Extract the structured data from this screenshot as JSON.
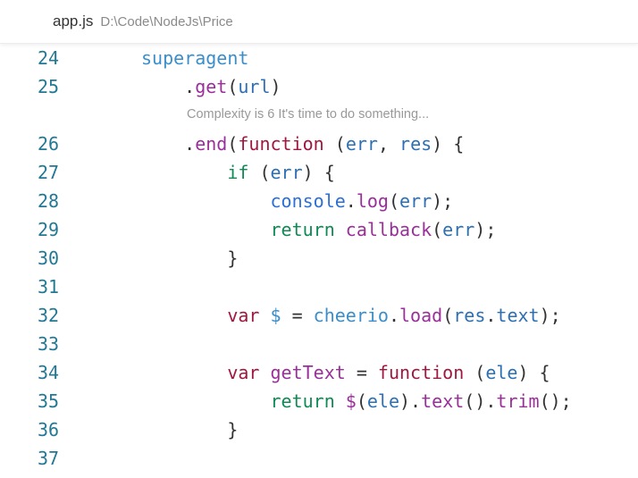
{
  "tab": {
    "title": "app.js",
    "path": "D:\\Code\\NodeJs\\Price"
  },
  "codelens": "Complexity is 6 It's time to do something...",
  "lines": [
    {
      "num": "24",
      "tokens": [
        {
          "t": "    superagent",
          "c": "k-ident"
        }
      ]
    },
    {
      "num": "25",
      "tokens": [
        {
          "t": "        .",
          "c": "k-punc"
        },
        {
          "t": "get",
          "c": "k-fn"
        },
        {
          "t": "(",
          "c": "k-punc"
        },
        {
          "t": "url",
          "c": "k-param"
        },
        {
          "t": ")",
          "c": "k-punc"
        }
      ]
    },
    {
      "num": "26",
      "tokens": [
        {
          "t": "        .",
          "c": "k-punc"
        },
        {
          "t": "end",
          "c": "k-fn"
        },
        {
          "t": "(",
          "c": "k-punc"
        },
        {
          "t": "function",
          "c": "k-kw"
        },
        {
          "t": " (",
          "c": "k-punc"
        },
        {
          "t": "err",
          "c": "k-param"
        },
        {
          "t": ", ",
          "c": "k-punc"
        },
        {
          "t": "res",
          "c": "k-param"
        },
        {
          "t": ") {",
          "c": "k-punc"
        }
      ]
    },
    {
      "num": "27",
      "tokens": [
        {
          "t": "            ",
          "c": "k-punc"
        },
        {
          "t": "if",
          "c": "k-ctrl"
        },
        {
          "t": " (",
          "c": "k-punc"
        },
        {
          "t": "err",
          "c": "k-param"
        },
        {
          "t": ") {",
          "c": "k-punc"
        }
      ]
    },
    {
      "num": "28",
      "tokens": [
        {
          "t": "                ",
          "c": "k-punc"
        },
        {
          "t": "console",
          "c": "k-obj"
        },
        {
          "t": ".",
          "c": "k-punc"
        },
        {
          "t": "log",
          "c": "k-fn"
        },
        {
          "t": "(",
          "c": "k-punc"
        },
        {
          "t": "err",
          "c": "k-param"
        },
        {
          "t": ");",
          "c": "k-punc"
        }
      ]
    },
    {
      "num": "29",
      "tokens": [
        {
          "t": "                ",
          "c": "k-punc"
        },
        {
          "t": "return",
          "c": "k-ctrl"
        },
        {
          "t": " ",
          "c": "k-punc"
        },
        {
          "t": "callback",
          "c": "k-fn"
        },
        {
          "t": "(",
          "c": "k-punc"
        },
        {
          "t": "err",
          "c": "k-param"
        },
        {
          "t": ");",
          "c": "k-punc"
        }
      ]
    },
    {
      "num": "30",
      "tokens": [
        {
          "t": "            }",
          "c": "k-punc"
        }
      ]
    },
    {
      "num": "31",
      "tokens": []
    },
    {
      "num": "32",
      "tokens": [
        {
          "t": "            ",
          "c": "k-punc"
        },
        {
          "t": "var",
          "c": "k-kw"
        },
        {
          "t": " ",
          "c": "k-punc"
        },
        {
          "t": "$",
          "c": "k-dollar"
        },
        {
          "t": " = ",
          "c": "k-punc"
        },
        {
          "t": "cheerio",
          "c": "k-ident"
        },
        {
          "t": ".",
          "c": "k-punc"
        },
        {
          "t": "load",
          "c": "k-fn"
        },
        {
          "t": "(",
          "c": "k-punc"
        },
        {
          "t": "res",
          "c": "k-param"
        },
        {
          "t": ".",
          "c": "k-punc"
        },
        {
          "t": "text",
          "c": "k-param"
        },
        {
          "t": ");",
          "c": "k-punc"
        }
      ]
    },
    {
      "num": "33",
      "tokens": []
    },
    {
      "num": "34",
      "tokens": [
        {
          "t": "            ",
          "c": "k-punc"
        },
        {
          "t": "var",
          "c": "k-kw"
        },
        {
          "t": " ",
          "c": "k-punc"
        },
        {
          "t": "getText",
          "c": "k-fn"
        },
        {
          "t": " = ",
          "c": "k-punc"
        },
        {
          "t": "function",
          "c": "k-kw"
        },
        {
          "t": " (",
          "c": "k-punc"
        },
        {
          "t": "ele",
          "c": "k-param"
        },
        {
          "t": ") {",
          "c": "k-punc"
        }
      ]
    },
    {
      "num": "35",
      "tokens": [
        {
          "t": "                ",
          "c": "k-punc"
        },
        {
          "t": "return",
          "c": "k-ctrl"
        },
        {
          "t": " ",
          "c": "k-punc"
        },
        {
          "t": "$",
          "c": "k-fn"
        },
        {
          "t": "(",
          "c": "k-punc"
        },
        {
          "t": "ele",
          "c": "k-param"
        },
        {
          "t": ").",
          "c": "k-punc"
        },
        {
          "t": "text",
          "c": "k-fn"
        },
        {
          "t": "().",
          "c": "k-punc"
        },
        {
          "t": "trim",
          "c": "k-fn"
        },
        {
          "t": "();",
          "c": "k-punc"
        }
      ]
    },
    {
      "num": "36",
      "tokens": [
        {
          "t": "            }",
          "c": "k-punc"
        }
      ]
    },
    {
      "num": "37",
      "tokens": []
    }
  ]
}
